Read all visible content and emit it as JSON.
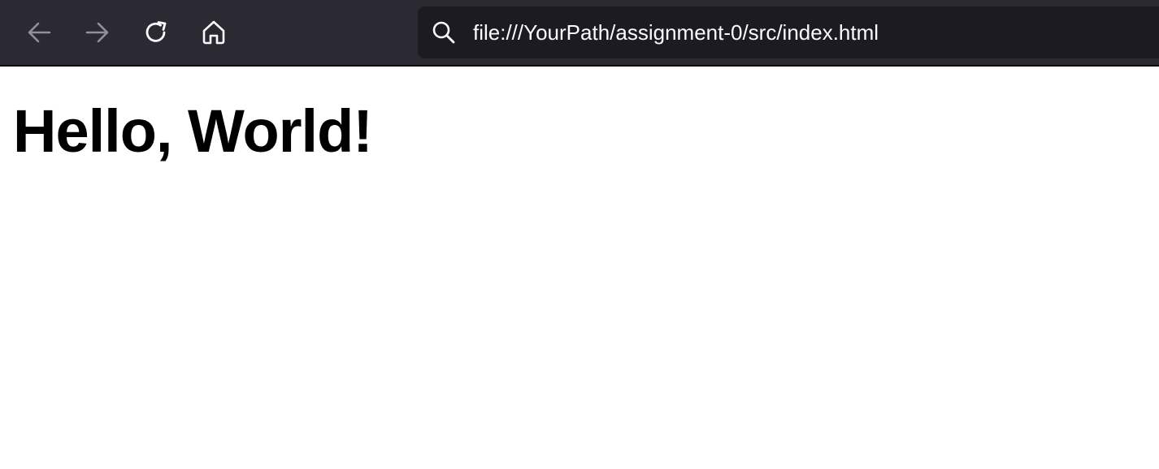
{
  "browser": {
    "toolbar": {
      "back_icon": "arrow-left-icon",
      "forward_icon": "arrow-right-icon",
      "reload_icon": "reload-icon",
      "home_icon": "home-icon"
    },
    "urlbar": {
      "icon": "search-icon",
      "url": "file:///YourPath/assignment-0/src/index.html"
    },
    "colors": {
      "toolbar_bg": "#2b2a33",
      "urlbar_bg": "#1c1b22",
      "icon_active": "#fbfbfe",
      "icon_disabled": "#8f8f9d"
    }
  },
  "page": {
    "heading": "Hello, World!"
  }
}
